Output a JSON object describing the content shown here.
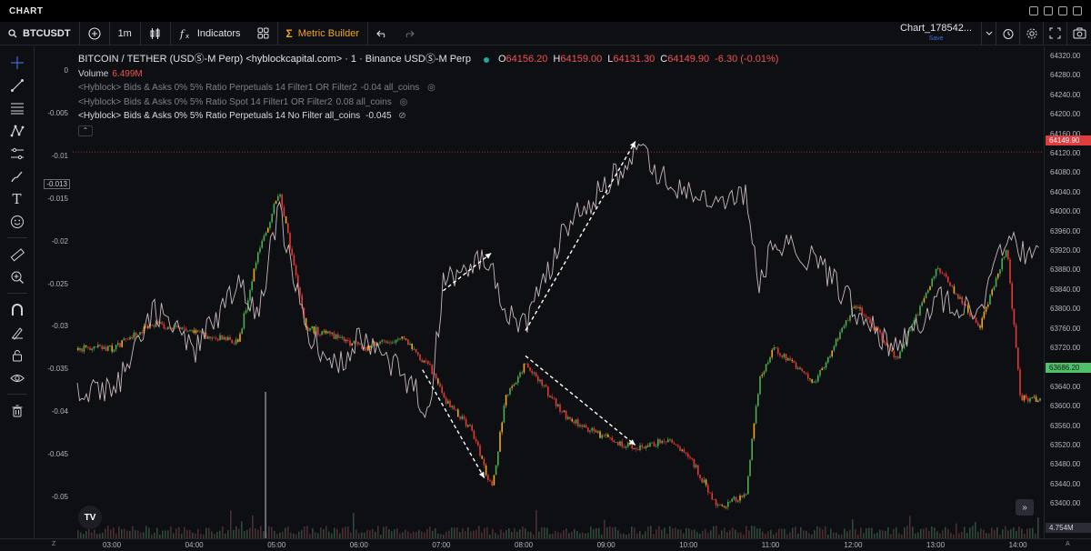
{
  "window": {
    "title": "CHART"
  },
  "toolbar": {
    "symbol": "BTCUSDT",
    "interval": "1m",
    "indicators_label": "Indicators",
    "metric_builder_label": "Metric Builder",
    "chart_name": "Chart_178542...",
    "save_label": "Save"
  },
  "legend": {
    "title": "BITCOIN / TETHER (USDⓈ-M Perp) <hyblockcapital.com> · 1 · Binance USDⓈ-M Perp",
    "ohlc": {
      "o_label": "O",
      "o": "64156.20",
      "h_label": "H",
      "h": "64159.00",
      "l_label": "L",
      "l": "64131.30",
      "c_label": "C",
      "c": "64149.90",
      "change": "-6.30 (-0.01%)"
    },
    "volume_label": "Volume",
    "volume_value": "6.499M",
    "indicators": [
      {
        "text": "<Hyblock> Bids & Asks 0% 5% Ratio Perpetuals 14 Filter1 OR Filter2",
        "value": "-0.04 all_coins"
      },
      {
        "text": "<Hyblock> Bids & Asks 0% 5% Ratio Spot 14 Filter1 OR Filter2",
        "value": "0.08 all_coins"
      },
      {
        "text": "<Hyblock> Bids & Asks 0% 5% Ratio Perpetuals 14 No Filter all_coins",
        "value": "-0.045"
      }
    ]
  },
  "left_axis": {
    "ticks": [
      "0",
      "-0.005",
      "-0.01",
      "-0.015",
      "-0.02",
      "-0.025",
      "-0.03",
      "-0.035",
      "-0.04",
      "-0.045",
      "-0.05"
    ],
    "tag": "-0.013"
  },
  "right_axis": {
    "ticks": [
      "64320.00",
      "64280.00",
      "64240.00",
      "64200.00",
      "64160.00",
      "64120.00",
      "64080.00",
      "64040.00",
      "64000.00",
      "63960.00",
      "63920.00",
      "63880.00",
      "63840.00",
      "63800.00",
      "63760.00",
      "63720.00",
      "63680.00",
      "63640.00",
      "63600.00",
      "63560.00",
      "63520.00",
      "63480.00",
      "63440.00",
      "63400.00"
    ],
    "price_tag": "64149.90",
    "green_tag": "63686.20",
    "volume_tag": "4.754M"
  },
  "time_axis": {
    "ticks": [
      "03:00",
      "04:00",
      "05:00",
      "06:00",
      "07:00",
      "08:00",
      "09:00",
      "10:00",
      "11:00",
      "12:00",
      "13:00",
      "14:00"
    ],
    "z_label": "Z",
    "a_label": "A"
  },
  "colors": {
    "up": "#4caf50",
    "down": "#e53935",
    "neutral_candle": "#f0a81c",
    "indicator_line": "#c8b8bc",
    "price_line": "#e03e3e",
    "arrow": "#ffffff"
  },
  "chart_data": {
    "type": "line",
    "series": [
      {
        "name": "BITCOIN / TETHER (USDⓈ-M Perp)",
        "axis": "right",
        "x": [
          "03:00",
          "03:30",
          "04:00",
          "04:30",
          "04:45",
          "05:00",
          "05:20",
          "05:45",
          "06:00",
          "06:30",
          "06:50",
          "07:00",
          "07:20",
          "07:35",
          "07:45",
          "08:00",
          "08:30",
          "09:00",
          "09:20",
          "09:45",
          "10:00",
          "10:20",
          "10:40",
          "10:50",
          "11:00",
          "11:30",
          "12:00",
          "12:30",
          "13:00",
          "13:30",
          "13:50",
          "14:00"
        ],
        "y": [
          63760,
          63810,
          63790,
          63770,
          63950,
          64070,
          63800,
          63780,
          63760,
          63780,
          63720,
          63660,
          63600,
          63480,
          63660,
          63730,
          63620,
          63580,
          63560,
          63580,
          63540,
          63440,
          63470,
          63700,
          63760,
          63690,
          63850,
          63740,
          63920,
          63800,
          63960,
          63660
        ]
      },
      {
        "name": "<Hyblock> Bids & Asks 0% 5% Ratio Perpetuals 14 No Filter all_coins",
        "axis": "left",
        "x": [
          "03:00",
          "03:30",
          "04:00",
          "04:30",
          "04:45",
          "05:00",
          "05:20",
          "05:45",
          "06:00",
          "06:30",
          "06:50",
          "07:00",
          "07:20",
          "07:35",
          "07:45",
          "08:00",
          "08:30",
          "09:00",
          "09:20",
          "09:45",
          "10:00",
          "10:20",
          "10:40",
          "10:50",
          "11:00",
          "11:30",
          "12:00",
          "12:30",
          "13:00",
          "13:30",
          "13:50",
          "14:00"
        ],
        "y": [
          -0.037,
          -0.027,
          -0.032,
          -0.024,
          -0.028,
          -0.015,
          -0.03,
          -0.034,
          -0.03,
          -0.035,
          -0.039,
          -0.024,
          -0.022,
          -0.021,
          -0.027,
          -0.029,
          -0.017,
          -0.012,
          -0.008,
          -0.012,
          -0.013,
          -0.015,
          -0.013,
          -0.025,
          -0.019,
          -0.021,
          -0.027,
          -0.032,
          -0.026,
          -0.027,
          -0.019,
          -0.02
        ]
      }
    ],
    "ylim_left": [
      -0.052,
      0.002
    ],
    "ylim_right": [
      63400,
      64340
    ],
    "grid": false
  }
}
